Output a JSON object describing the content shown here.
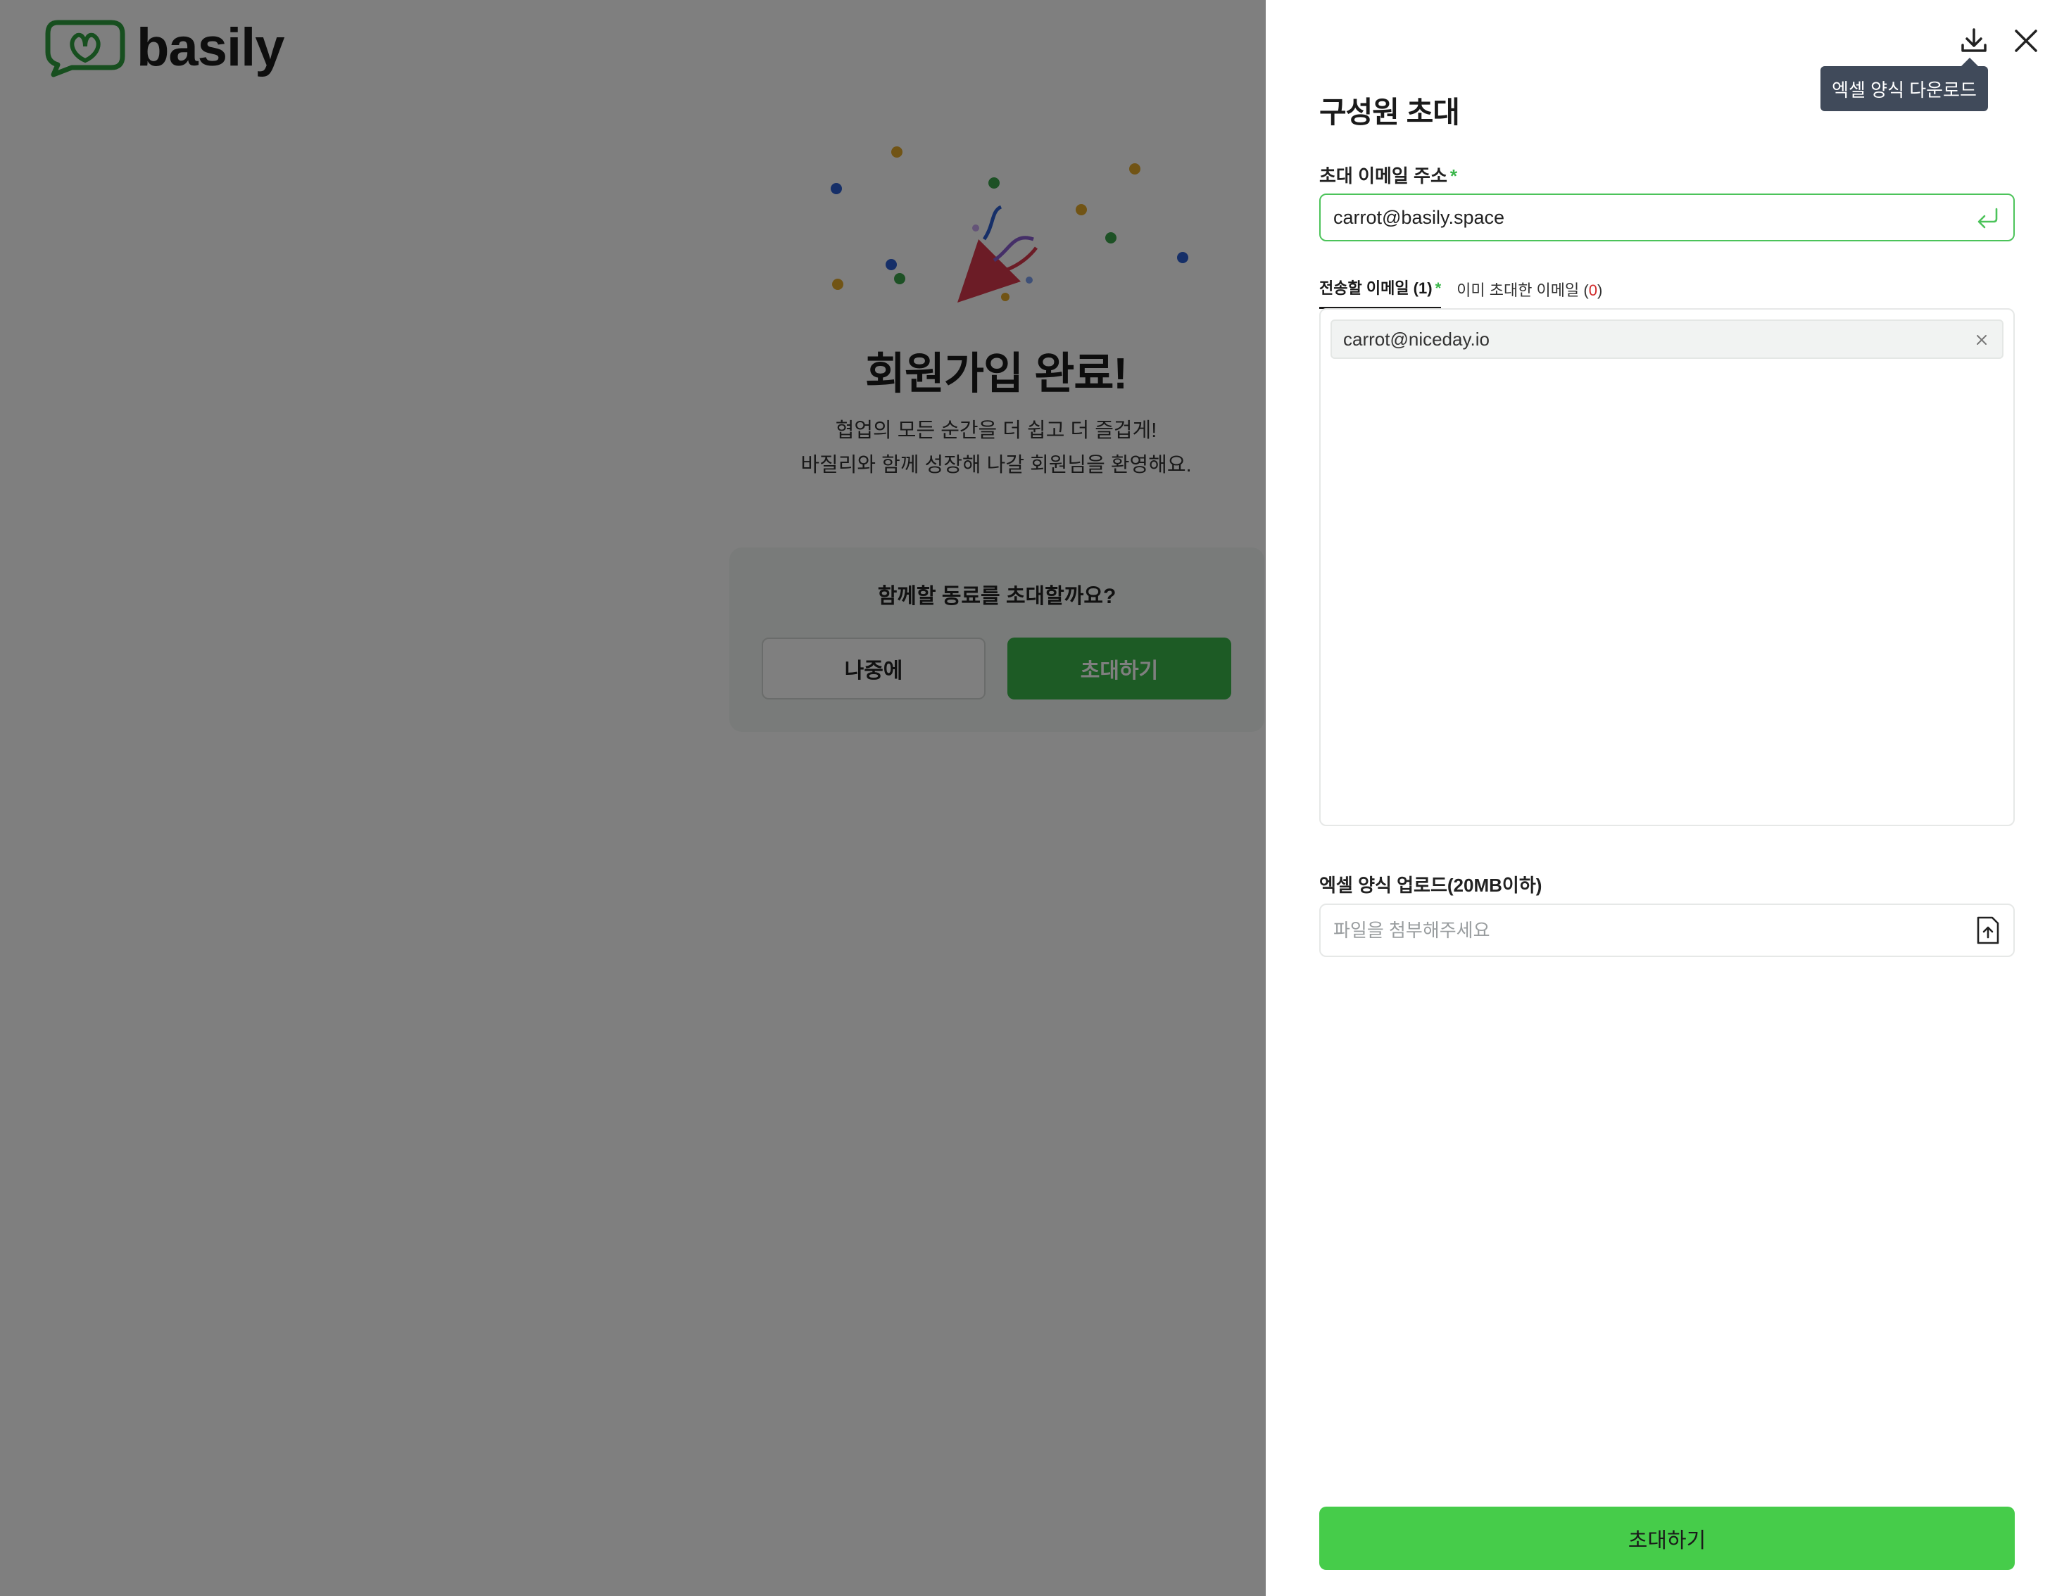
{
  "brand": {
    "name": "basily",
    "color": "#2f9e3f"
  },
  "signup": {
    "title": "회원가입 완료!",
    "subtitle_line1": "협업의 모든 순간을 더 쉽고 더 즐겁게!",
    "subtitle_line2": "바질리와 함께 성장해 나갈 회원님을 환영해요."
  },
  "invite_card": {
    "question": "함께할 동료를 초대할까요?",
    "later_label": "나중에",
    "invite_label": "초대하기"
  },
  "drawer": {
    "title": "구성원 초대",
    "download_tooltip": "엑셀 양식 다운로드",
    "email_label": "초대 이메일 주소",
    "required_mark": "*",
    "email_value": "carrot@basily.space",
    "tabs": {
      "to_send_label": "전송할 이메일 (1)",
      "already_invited_prefix": "이미 초대한 이메일 (",
      "already_invited_count": "0",
      "already_invited_suffix": ")"
    },
    "emails": [
      {
        "address": "carrot@niceday.io"
      }
    ],
    "upload_label": "엑셀 양식 업로드(20MB이하)",
    "upload_placeholder": "파일을 첨부해주세요",
    "submit_label": "초대하기"
  },
  "colors": {
    "accent_green": "#46cc4a",
    "input_focus_border": "#4cc35a",
    "tooltip_bg": "#404a5a",
    "error_red": "#d12b2b"
  },
  "icons": {
    "download": "download-icon",
    "close": "close-icon",
    "enter": "enter-icon",
    "chip_remove": "x-icon",
    "file_upload": "file-upload-icon",
    "party": "party-popper-icon"
  }
}
